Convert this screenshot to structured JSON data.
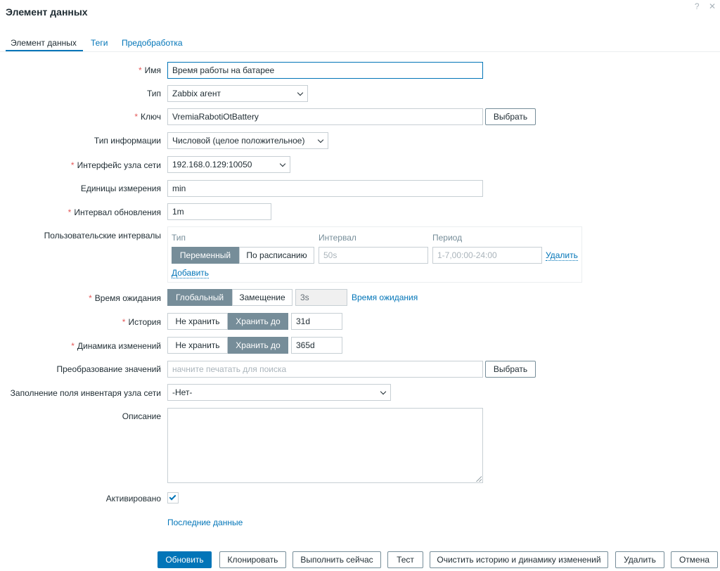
{
  "dialog": {
    "title": "Элемент данных",
    "help_icon": "?",
    "close_icon": "✕"
  },
  "tabs": [
    {
      "label": "Элемент данных",
      "active": true
    },
    {
      "label": "Теги",
      "active": false
    },
    {
      "label": "Предобработка",
      "active": false
    }
  ],
  "form": {
    "name": {
      "label": "Имя",
      "value": "Время работы на батарее"
    },
    "type": {
      "label": "Тип",
      "value": "Zabbix агент"
    },
    "key": {
      "label": "Ключ",
      "value": "VremiaRabotiOtBattery",
      "select_btn": "Выбрать"
    },
    "info_type": {
      "label": "Тип информации",
      "value": "Числовой (целое положительное)"
    },
    "interface": {
      "label": "Интерфейс узла сети",
      "value": "192.168.0.129:10050"
    },
    "units": {
      "label": "Единицы измерения",
      "value": "min"
    },
    "interval": {
      "label": "Интервал обновления",
      "value": "1m"
    },
    "custom_intervals": {
      "label": "Пользовательские интервалы",
      "col_type": "Тип",
      "col_interval": "Интервал",
      "col_period": "Период",
      "seg_flexible": "Переменный",
      "seg_scheduling": "По расписанию",
      "interval_placeholder": "50s",
      "period_placeholder": "1-7,00:00-24:00",
      "remove": "Удалить",
      "add": "Добавить"
    },
    "timeout": {
      "label": "Время ожидания",
      "seg_global": "Глобальный",
      "seg_override": "Замещение",
      "value": "3s",
      "link": "Время ожидания"
    },
    "history": {
      "label": "История",
      "seg_off": "Не хранить",
      "seg_on": "Хранить до",
      "value": "31d"
    },
    "trends": {
      "label": "Динамика изменений",
      "seg_off": "Не хранить",
      "seg_on": "Хранить до",
      "value": "365d"
    },
    "valuemap": {
      "label": "Преобразование значений",
      "placeholder": "начните печатать для поиска",
      "select_btn": "Выбрать"
    },
    "inventory": {
      "label": "Заполнение поля инвентаря узла сети",
      "value": "-Нет-"
    },
    "description": {
      "label": "Описание",
      "value": ""
    },
    "enabled": {
      "label": "Активировано",
      "checked": true
    },
    "latest_data": "Последние данные"
  },
  "footer": {
    "update": "Обновить",
    "clone": "Клонировать",
    "execute_now": "Выполнить сейчас",
    "test": "Тест",
    "clear_history": "Очистить историю и динамику изменений",
    "delete": "Удалить",
    "cancel": "Отмена"
  },
  "colors": {
    "accent": "#0275b8",
    "required": "#e45959",
    "segment_on": "#768d99"
  }
}
